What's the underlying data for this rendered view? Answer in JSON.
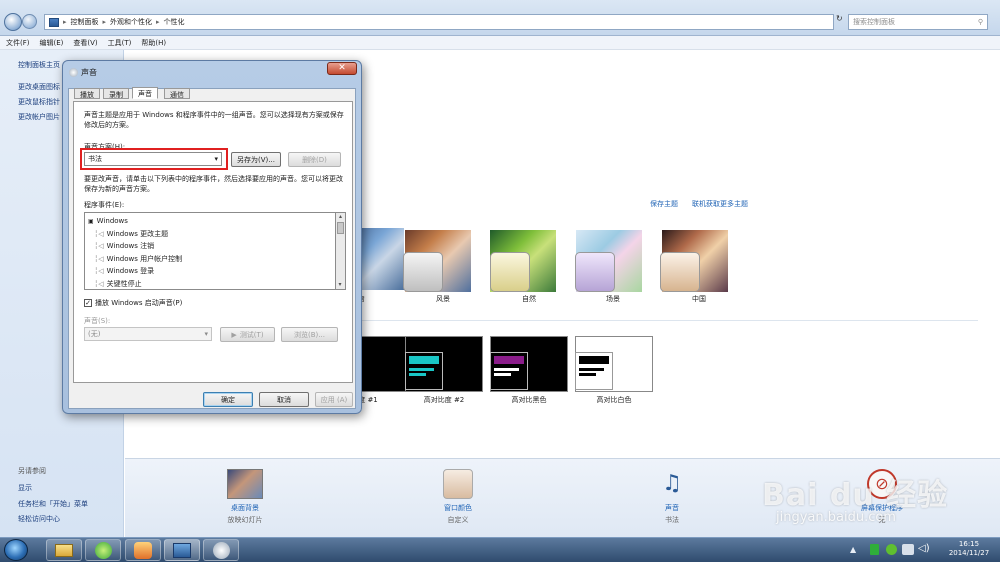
{
  "address": {
    "crumbs": [
      "控制面板",
      "外观和个性化",
      "个性化"
    ],
    "search_placeholder": "搜索控制面板"
  },
  "menu": [
    "文件(F)",
    "编辑(E)",
    "查看(V)",
    "工具(T)",
    "帮助(H)"
  ],
  "left_nav": {
    "links": [
      "控制面板主页",
      "更改桌面图标",
      "更改鼠标指针",
      "更改帐户图片"
    ],
    "see_also_title": "另请参阅",
    "see_also": [
      "显示",
      "任务栏和「开始」菜单",
      "轻松访问中心"
    ]
  },
  "main": {
    "save_theme": "保存主题",
    "get_more": "联机获取更多主题",
    "themes": [
      "物",
      "风景",
      "自然",
      "场景",
      "中国"
    ],
    "hc_themes": [
      "度 #1",
      "高对比度 #2",
      "高对比黑色",
      "高对比白色"
    ]
  },
  "bottom": {
    "items": [
      {
        "title": "桌面背景",
        "sub": "放映幻灯片"
      },
      {
        "title": "窗口颜色",
        "sub": "自定义"
      },
      {
        "title": "声音",
        "sub": "书法"
      },
      {
        "title": "屏幕保护程序",
        "sub": "无"
      }
    ]
  },
  "dialog": {
    "title": "声音",
    "tabs": [
      "播放",
      "录制",
      "声音",
      "通信"
    ],
    "active_tab": 2,
    "description": "声音主题是应用于 Windows 和程序事件中的一组声音。您可以选择现有方案或保存修改后的方案。",
    "scheme_label": "声音方案(H):",
    "scheme_value": "书法",
    "save_as": "另存为(V)...",
    "delete": "删除(D)",
    "instructions": "要更改声音，请单击以下列表中的程序事件，然后选择要应用的声音。您可以将更改保存为新的声音方案。",
    "events_label": "程序事件(E):",
    "events": [
      "Windows",
      "Windows 更改主题",
      "Windows 注销",
      "Windows 用户帐户控制",
      "Windows 登录",
      "关键性停止"
    ],
    "play_startup": "播放 Windows 启动声音(P)",
    "sound_label": "声音(S):",
    "sound_value": "(无)",
    "test": "测试(T)",
    "browse": "浏览(B)...",
    "ok": "确定",
    "cancel": "取消",
    "apply": "应用 (A)"
  },
  "taskbar": {
    "time": "16:15",
    "date": "2014/11/27"
  },
  "watermark": {
    "brand": "Bai du 经验",
    "url": "jingyan.baidu.com"
  },
  "colors": {
    "highlight_border": "#e02020",
    "link": "#1f63b5"
  }
}
